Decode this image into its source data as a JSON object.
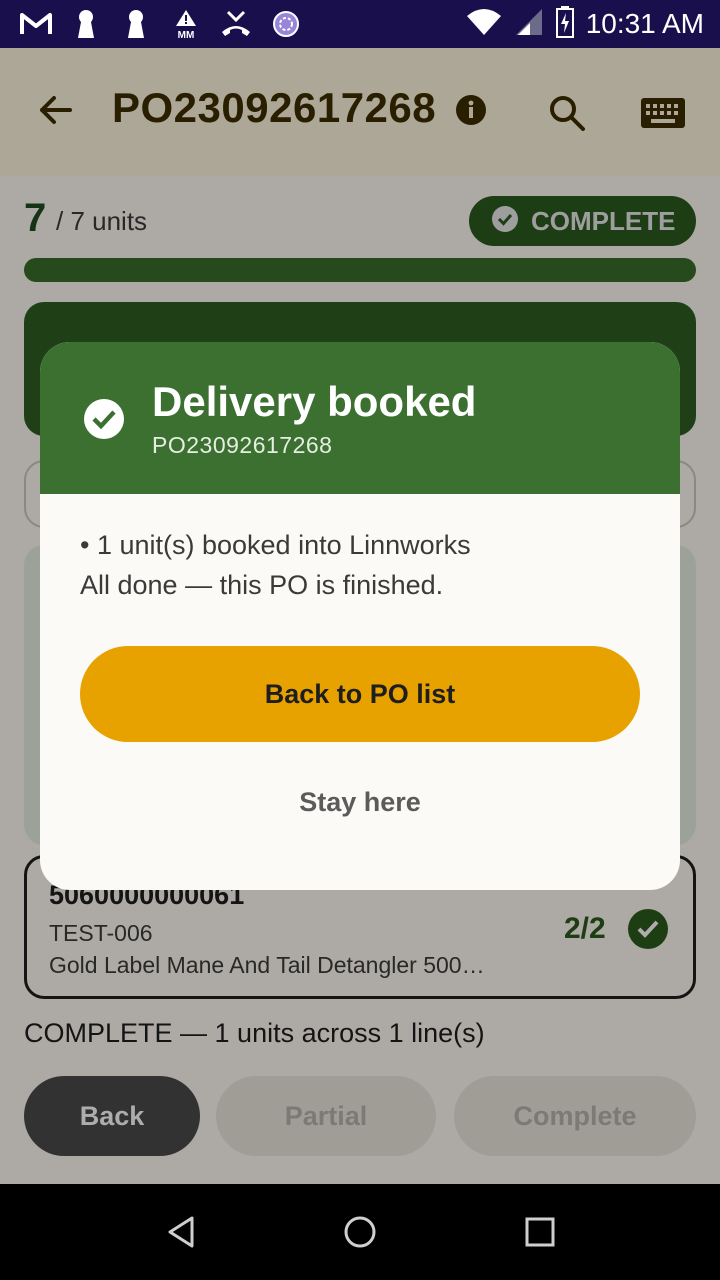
{
  "status_bar": {
    "time": "10:31 AM",
    "left_icons": [
      "gmail-icon",
      "keyhole-icon",
      "keyhole-icon",
      "mm-warning-icon",
      "missed-call-icon",
      "sync-circle-icon"
    ],
    "mm_label": "MM"
  },
  "appbar": {
    "title": "PO23092617268"
  },
  "progress": {
    "received": "7",
    "total_label": "/ 7 units",
    "fraction": 1.0
  },
  "status_chip": {
    "label": "COMPLETE"
  },
  "line_item": {
    "barcode": "5060000000061",
    "sku": "TEST-006",
    "name": "Gold Label Mane And Tail Detangler 500…",
    "qty": "2/2"
  },
  "summary": "COMPLETE — 1 units across 1 line(s)",
  "actions": {
    "back": "Back",
    "partial": "Partial",
    "complete": "Complete"
  },
  "dialog": {
    "title": "Delivery booked",
    "subtitle": "PO23092617268",
    "line1": "• 1 unit(s) booked into Linnworks",
    "line2": "All done — this PO is finished.",
    "primary": "Back to PO list",
    "secondary": "Stay here"
  },
  "colors": {
    "accent": "#e8a200",
    "success": "#3c7031",
    "status_bar": "#1a0f4d"
  }
}
